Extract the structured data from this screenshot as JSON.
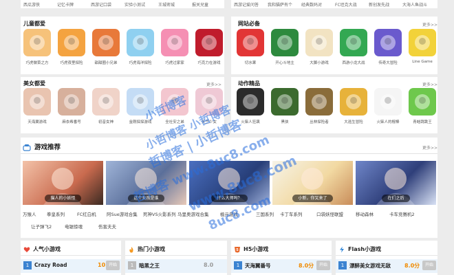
{
  "top_labels_left": [
    "西瓜游侠",
    "记忆卡牌",
    "西游记口袋",
    "实验小测试",
    "王城密城",
    "报关兒童"
  ],
  "top_labels_right": [
    "西游记爱问答",
    "我和猫萨有个",
    "经典数码对",
    "FC坦克大战",
    "新创发先战",
    "大海人鱼战斗"
  ],
  "sections": {
    "kids": {
      "title": "儿童都爱",
      "more": "更多>>",
      "items": [
        "巧虎做菜之方",
        "巧虎夜里探险",
        "甜甜圈小兄弟",
        "巧虎海洋探险",
        "巧虎过家家",
        "巧克力在游戏"
      ]
    },
    "classic": {
      "title": "网站必备",
      "more": "更多>>",
      "items": [
        "切水果",
        "开心斗地主",
        "大脚小游戏",
        "西游小龙大战",
        "传奇大冒险",
        "Line Game"
      ]
    },
    "beauty": {
      "title": "美女都爱",
      "more": "更多>>",
      "items": [
        "天海翼游戏",
        "麻衣希番号",
        "初音女神",
        "金刚探探游戏",
        "全社安之弟",
        "天竺少女"
      ]
    },
    "action": {
      "title": "动作精品",
      "more": "更多>>",
      "items": [
        "火柴人狂飙",
        "黑侠",
        "丛林探险者",
        "大逃生冒险",
        "火柴人的棍棒",
        "青蛙跳跳王"
      ]
    }
  },
  "recommend": {
    "title": "游戏推荐",
    "more": "更多>>",
    "banners": [
      "猫人的小妖怪",
      "这个女孩是谁",
      "什么大师吗？",
      "小新，你又来了",
      "在们之后"
    ]
  },
  "tags_row1": [
    "万猴人",
    "拳皇系列",
    "FC红白机",
    "阿Sue游戏合集",
    "死神VS火影系列",
    "马里奥游戏合集",
    "植元游戏",
    "三国系列",
    "卡丁车系列",
    "口袋妖怪联盟",
    "移动森林",
    "卡车竞赛机2"
  ],
  "tags_row2": [
    "让子弹飞2",
    "电锯惊魂",
    "伤害夫夫"
  ],
  "lists": [
    {
      "title": "人气小游戏",
      "first_name": "Crazy Road",
      "first_score": "10.0",
      "btn": "开始"
    },
    {
      "title": "热门小游戏",
      "first_name": "暗黑之王",
      "first_score": "8.0",
      "btn": "开始"
    },
    {
      "title": "H5小游戏",
      "first_name": "天海翼番号",
      "first_score": "8.0分",
      "btn": "开始"
    },
    {
      "title": "Flash小游戏",
      "first_name": "漂醉美女游戏无敌",
      "first_score": "8.0分",
      "btn": "开始"
    }
  ],
  "watermarks": [
    "小哲博客",
    "小哲博客 小哲博客",
    "哲博客 | 小哲博客",
    "哲博客 www.8uc8.com",
    "www.8uc8.com",
    "8uc8.com"
  ],
  "colors": {
    "accent": "#3b83d1",
    "score": "#f08a00",
    "watermark": "#286edc"
  }
}
